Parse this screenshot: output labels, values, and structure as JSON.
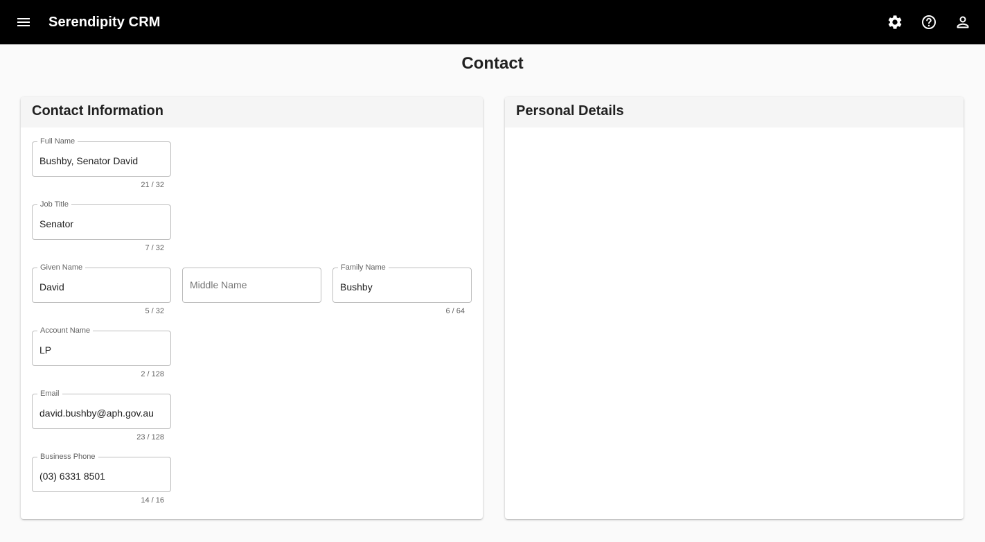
{
  "app": {
    "title": "Serendipity CRM"
  },
  "page": {
    "title": "Contact"
  },
  "contact_info": {
    "title": "Contact Information",
    "full_name": {
      "label": "Full Name",
      "value": "Bushby, Senator David",
      "counter": "21 / 32"
    },
    "job_title": {
      "label": "Job Title",
      "value": "Senator",
      "counter": "7 / 32"
    },
    "given_name": {
      "label": "Given Name",
      "value": "David",
      "counter": "5 / 32"
    },
    "middle_name": {
      "placeholder": "Middle Name",
      "value": ""
    },
    "family_name": {
      "label": "Family Name",
      "value": "Bushby",
      "counter": "6 / 64"
    },
    "account_name": {
      "label": "Account Name",
      "value": "LP",
      "counter": "2 / 128"
    },
    "email": {
      "label": "Email",
      "value": "david.bushby@aph.gov.au",
      "counter": "23 / 128"
    },
    "business_phone": {
      "label": "Business Phone",
      "value": "(03) 6331 8501",
      "counter": "14 / 16"
    }
  },
  "personal_details": {
    "title": "Personal Details"
  },
  "icons": {
    "menu": "menu-icon",
    "settings": "gear-icon",
    "help": "help-icon",
    "account": "person-icon"
  },
  "colors": {
    "appbar": "#000000",
    "background": "#fafafa",
    "card_header": "#f5f5f5"
  }
}
